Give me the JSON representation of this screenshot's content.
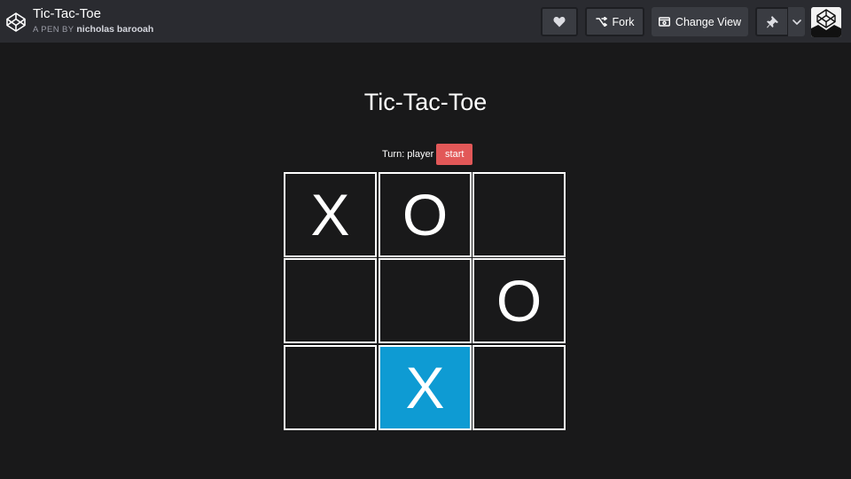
{
  "header": {
    "title": "Tic-Tac-Toe",
    "by_label": "A PEN BY",
    "author": "nicholas barooah",
    "fork_label": "Fork",
    "change_view_label": "Change View",
    "icons": [
      "codepen-logo-icon",
      "heart-icon",
      "fork-icon",
      "change-view-icon",
      "pin-icon",
      "chevron-down-icon"
    ]
  },
  "game": {
    "title": "Tic-Tac-Toe",
    "turn_label": "Turn:",
    "turn_value": "player",
    "start_label": "start",
    "accent_color": "#e25858",
    "highlight_color": "#0e9bd3",
    "board": [
      [
        "X",
        "O",
        ""
      ],
      [
        "",
        "",
        "O"
      ],
      [
        "",
        "X",
        ""
      ]
    ],
    "highlighted_cell": [
      2,
      1
    ]
  }
}
